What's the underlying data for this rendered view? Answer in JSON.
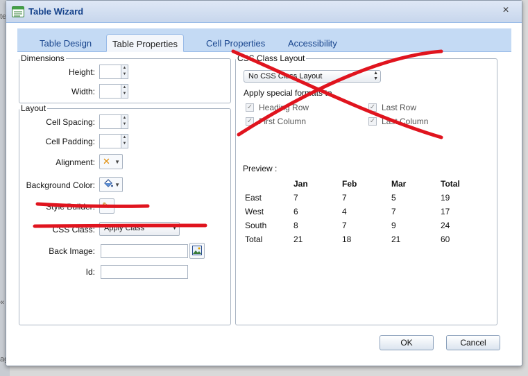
{
  "window": {
    "title": "Table Wizard",
    "close_glyph": "×",
    "icon": "table-wizard-icon"
  },
  "tabs": [
    {
      "label": "Table Design",
      "active": false
    },
    {
      "label": "Table Properties",
      "active": true
    },
    {
      "label": "Cell Properties",
      "active": false
    },
    {
      "label": "Accessibility",
      "active": false
    }
  ],
  "dimensions": {
    "legend": "Dimensions",
    "height_label": "Height:",
    "height_value": "",
    "width_label": "Width:",
    "width_value": ""
  },
  "layout": {
    "legend": "Layout",
    "cell_spacing_label": "Cell Spacing:",
    "cell_padding_label": "Cell Padding:",
    "alignment_label": "Alignment:",
    "bgcolor_label": "Background Color:",
    "style_builder_label": "Style Builder:",
    "css_class_label": "CSS Class:",
    "css_class_value": "Apply Class",
    "back_image_label": "Back Image:",
    "back_image_value": "",
    "id_label": "Id:",
    "id_value": ""
  },
  "css_layout": {
    "legend": "CSS Class Layout",
    "select_value": "No CSS Class Layout",
    "apply_label": "Apply special formats to",
    "options": [
      {
        "label": "Heading Row",
        "checked": true
      },
      {
        "label": "Last Row",
        "checked": true
      },
      {
        "label": "First Column",
        "checked": true
      },
      {
        "label": "Last Column",
        "checked": true
      }
    ]
  },
  "preview": {
    "label": "Preview :",
    "headers": [
      "",
      "Jan",
      "Feb",
      "Mar",
      "Total"
    ],
    "rows": [
      [
        "East",
        "7",
        "7",
        "5",
        "19"
      ],
      [
        "West",
        "6",
        "4",
        "7",
        "17"
      ],
      [
        "South",
        "8",
        "7",
        "9",
        "24"
      ],
      [
        "Total",
        "21",
        "18",
        "21",
        "60"
      ]
    ]
  },
  "buttons": {
    "ok": "OK",
    "cancel": "Cancel"
  },
  "colors": {
    "accent": "#15428b",
    "tab_bar": "#c4daf4",
    "annotation_red": "#e0141e"
  }
}
